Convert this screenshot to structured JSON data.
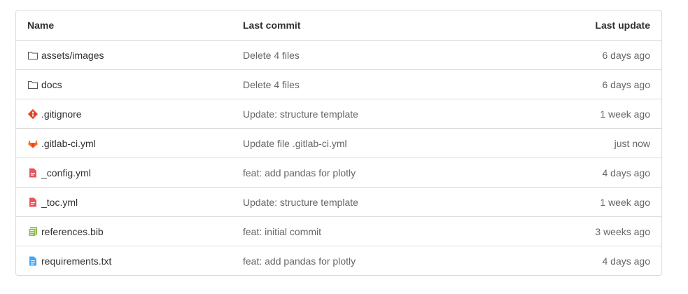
{
  "table": {
    "headers": {
      "name": "Name",
      "last_commit": "Last commit",
      "last_update": "Last update"
    },
    "rows": [
      {
        "name": "assets/images",
        "icon": "folder-icon",
        "commit": "Delete 4 files",
        "updated": "6 days ago"
      },
      {
        "name": "docs",
        "icon": "folder-icon",
        "commit": "Delete 4 files",
        "updated": "6 days ago"
      },
      {
        "name": ".gitignore",
        "icon": "git-icon",
        "commit": "Update: structure template",
        "updated": "1 week ago"
      },
      {
        "name": ".gitlab-ci.yml",
        "icon": "gitlab-icon",
        "commit": "Update file .gitlab-ci.yml",
        "updated": "just now"
      },
      {
        "name": "_config.yml",
        "icon": "yaml-file-icon",
        "commit": "feat: add pandas for plotly",
        "updated": "4 days ago"
      },
      {
        "name": "_toc.yml",
        "icon": "yaml-file-icon",
        "commit": "Update: structure template",
        "updated": "1 week ago"
      },
      {
        "name": "references.bib",
        "icon": "bib-file-icon",
        "commit": "feat: initial commit",
        "updated": "3 weeks ago"
      },
      {
        "name": "requirements.txt",
        "icon": "text-file-icon",
        "commit": "feat: add pandas for plotly",
        "updated": "4 days ago"
      }
    ]
  },
  "colors": {
    "border": "#dbdbdb",
    "git": "#e24329",
    "gitlab": "#fc6d26",
    "yaml": "#e8565e",
    "bib": "#7cb342",
    "text_file": "#42a5f5"
  }
}
